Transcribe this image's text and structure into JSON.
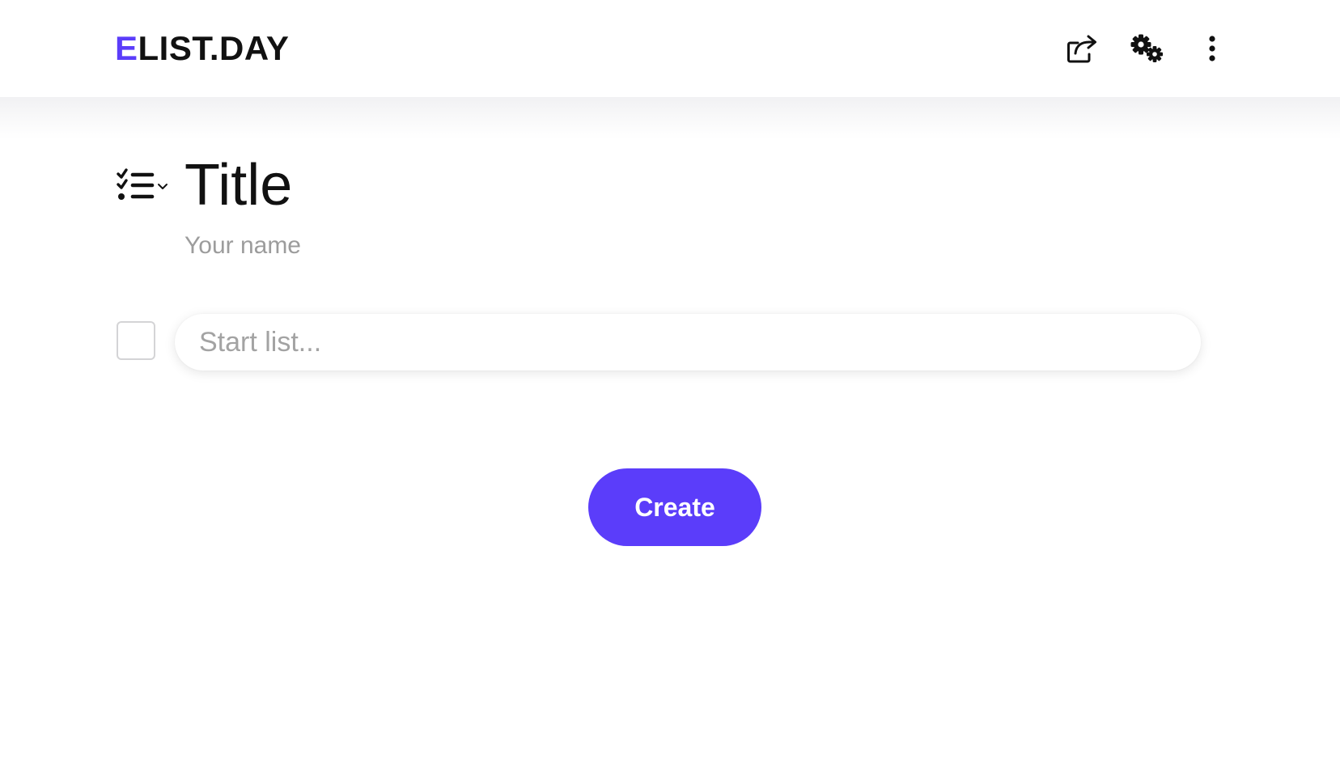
{
  "colors": {
    "accent": "#5b3dfa",
    "text": "#111111",
    "placeholder": "#a3a3a3"
  },
  "header": {
    "logo_first_letter": "E",
    "logo_rest": "LIST.DAY",
    "icons": [
      "share-icon",
      "settings-gears-icon",
      "more-vertical-icon"
    ]
  },
  "list": {
    "type_icon": "checklist-icon",
    "title_placeholder": "Title",
    "name_placeholder": "Your name",
    "item_placeholder": "Start list..."
  },
  "actions": {
    "create_label": "Create"
  }
}
